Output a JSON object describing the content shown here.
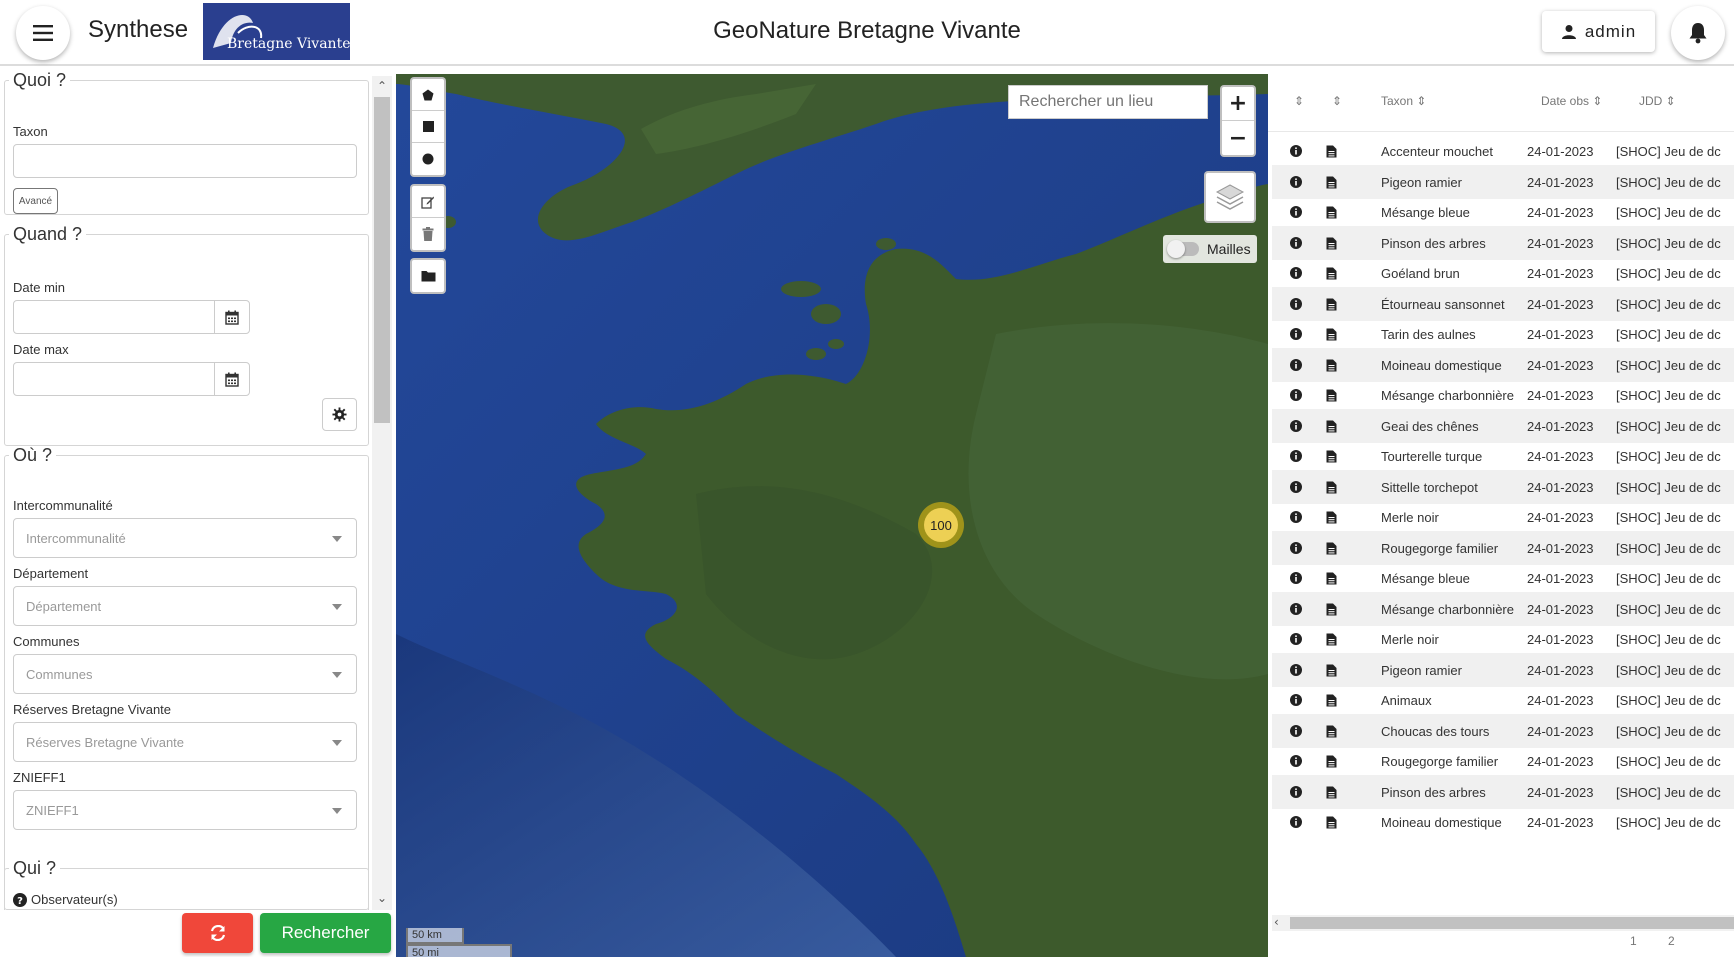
{
  "header": {
    "module_title": "Synthese",
    "logo_text": "Bretagne Vivante",
    "app_title": "GeoNature Bretagne Vivante",
    "user_label": "admin"
  },
  "filters": {
    "quoi": {
      "legend": "Quoi ?",
      "taxon_label": "Taxon",
      "taxon_value": "",
      "advanced_label": "Avancé"
    },
    "quand": {
      "legend": "Quand ?",
      "date_min_label": "Date min",
      "date_min_value": "",
      "date_max_label": "Date max",
      "date_max_value": ""
    },
    "ou": {
      "legend": "Où ?",
      "intercommunalite_label": "Intercommunalité",
      "intercommunalite_placeholder": "Intercommunalité",
      "departement_label": "Département",
      "departement_placeholder": "Département",
      "communes_label": "Communes",
      "communes_placeholder": "Communes",
      "reserves_label": "Réserves Bretagne Vivante",
      "reserves_placeholder": "Réserves Bretagne Vivante",
      "znieff_label": "ZNIEFF1",
      "znieff_placeholder": "ZNIEFF1"
    },
    "qui": {
      "legend": "Qui ?",
      "observateurs_label": "Observateur(s)"
    },
    "search_button": "Rechercher"
  },
  "map": {
    "place_search_placeholder": "Rechercher un lieu",
    "zoom_in": "+",
    "zoom_out": "−",
    "mailles_label": "Mailles",
    "cluster_count": "100",
    "scale_km": "50 km",
    "scale_mi": "50 mi"
  },
  "table": {
    "columns": [
      "Taxon",
      "Date obs",
      "JDD"
    ],
    "rows": [
      {
        "taxon": "Accenteur mouchet",
        "date": "24-01-2023",
        "jdd": "[SHOC] Jeu de dc"
      },
      {
        "taxon": "Pigeon ramier",
        "date": "24-01-2023",
        "jdd": "[SHOC] Jeu de dc"
      },
      {
        "taxon": "Mésange bleue",
        "date": "24-01-2023",
        "jdd": "[SHOC] Jeu de dc"
      },
      {
        "taxon": "Pinson des arbres",
        "date": "24-01-2023",
        "jdd": "[SHOC] Jeu de dc"
      },
      {
        "taxon": "Goéland brun",
        "date": "24-01-2023",
        "jdd": "[SHOC] Jeu de dc"
      },
      {
        "taxon": "Étourneau sansonnet",
        "date": "24-01-2023",
        "jdd": "[SHOC] Jeu de dc"
      },
      {
        "taxon": "Tarin des aulnes",
        "date": "24-01-2023",
        "jdd": "[SHOC] Jeu de dc"
      },
      {
        "taxon": "Moineau domestique",
        "date": "24-01-2023",
        "jdd": "[SHOC] Jeu de dc"
      },
      {
        "taxon": "Mésange charbonnière",
        "date": "24-01-2023",
        "jdd": "[SHOC] Jeu de dc"
      },
      {
        "taxon": "Geai des chênes",
        "date": "24-01-2023",
        "jdd": "[SHOC] Jeu de dc"
      },
      {
        "taxon": "Tourterelle turque",
        "date": "24-01-2023",
        "jdd": "[SHOC] Jeu de dc"
      },
      {
        "taxon": "Sittelle torchepot",
        "date": "24-01-2023",
        "jdd": "[SHOC] Jeu de dc"
      },
      {
        "taxon": "Merle noir",
        "date": "24-01-2023",
        "jdd": "[SHOC] Jeu de dc"
      },
      {
        "taxon": "Rougegorge familier",
        "date": "24-01-2023",
        "jdd": "[SHOC] Jeu de dc"
      },
      {
        "taxon": "Mésange bleue",
        "date": "24-01-2023",
        "jdd": "[SHOC] Jeu de dc"
      },
      {
        "taxon": "Mésange charbonnière",
        "date": "24-01-2023",
        "jdd": "[SHOC] Jeu de dc"
      },
      {
        "taxon": "Merle noir",
        "date": "24-01-2023",
        "jdd": "[SHOC] Jeu de dc"
      },
      {
        "taxon": "Pigeon ramier",
        "date": "24-01-2023",
        "jdd": "[SHOC] Jeu de dc"
      },
      {
        "taxon": "Animaux",
        "date": "24-01-2023",
        "jdd": "[SHOC] Jeu de dc"
      },
      {
        "taxon": "Choucas des tours",
        "date": "24-01-2023",
        "jdd": "[SHOC] Jeu de dc"
      },
      {
        "taxon": "Rougegorge familier",
        "date": "24-01-2023",
        "jdd": "[SHOC] Jeu de dc"
      },
      {
        "taxon": "Pinson des arbres",
        "date": "24-01-2023",
        "jdd": "[SHOC] Jeu de dc"
      },
      {
        "taxon": "Moineau domestique",
        "date": "24-01-2023",
        "jdd": "[SHOC] Jeu de dc"
      }
    ],
    "pagination": [
      "1",
      "2"
    ]
  },
  "colors": {
    "search_button": "#27a744",
    "reset_button": "#f0473a",
    "logo_bg": "#2a3f8f",
    "cluster": "#f1d357",
    "sea": "#1f3f87",
    "land": "#3d5a2c"
  },
  "icons": [
    "menu-icon",
    "user-icon",
    "bell-icon",
    "calendar-icon",
    "gear-icon",
    "refresh-icon",
    "polygon-icon",
    "square-icon",
    "circle-icon",
    "edit-icon",
    "trash-icon",
    "folder-icon",
    "layers-icon",
    "info-icon",
    "file-icon",
    "sort-icon",
    "question-icon"
  ]
}
